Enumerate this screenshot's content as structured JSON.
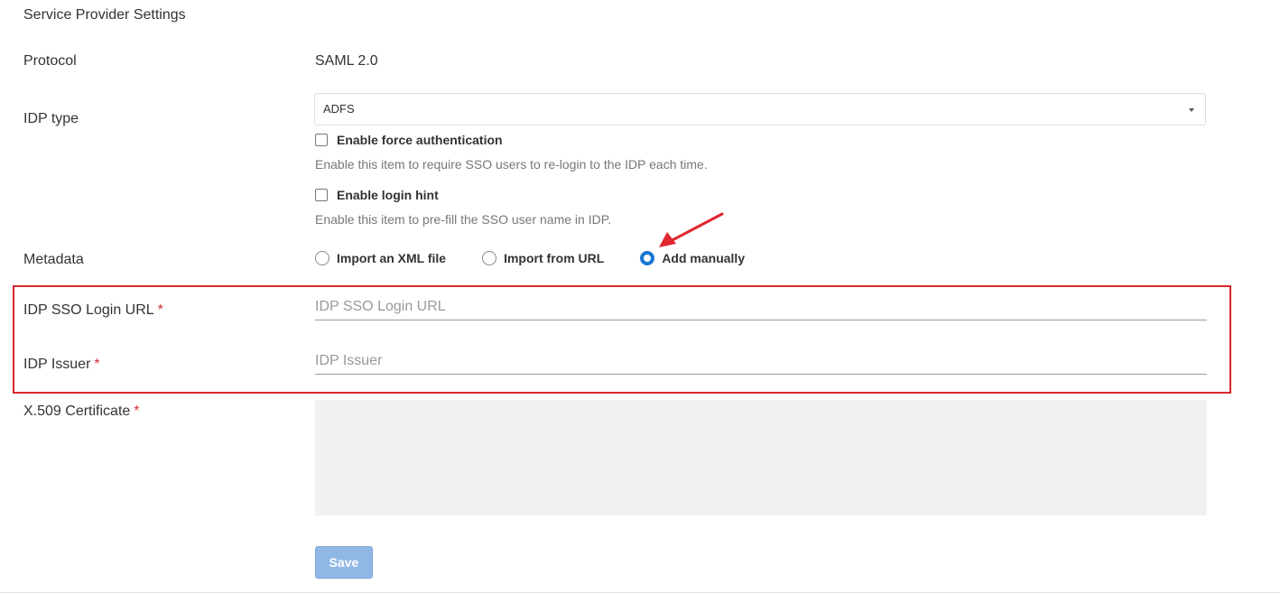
{
  "section_title": "Service Provider Settings",
  "protocol": {
    "label": "Protocol",
    "value": "SAML 2.0"
  },
  "idp_type": {
    "label": "IDP type",
    "selected": "ADFS"
  },
  "force_auth": {
    "label": "Enable force authentication",
    "help": "Enable this item to require SSO users to re-login to the IDP each time.",
    "checked": false
  },
  "login_hint": {
    "label": "Enable login hint",
    "help": "Enable this item to pre-fill the SSO user name in IDP.",
    "checked": false
  },
  "metadata": {
    "label": "Metadata",
    "options": [
      "Import an XML file",
      "Import from URL",
      "Add manually"
    ],
    "selected": "Add manually"
  },
  "sso_login_url": {
    "label": "IDP SSO Login URL",
    "required_mark": "*",
    "placeholder": "IDP SSO Login URL"
  },
  "idp_issuer": {
    "label": "IDP Issuer",
    "required_mark": "*",
    "placeholder": "IDP Issuer"
  },
  "certificate": {
    "label": "X.509 Certificate",
    "required_mark": "*"
  },
  "save_label": "Save",
  "colors": {
    "accent": "#1976d2",
    "highlight": "#d9262e",
    "required": "#d32f2f",
    "save_bg": "#90b8e4"
  }
}
